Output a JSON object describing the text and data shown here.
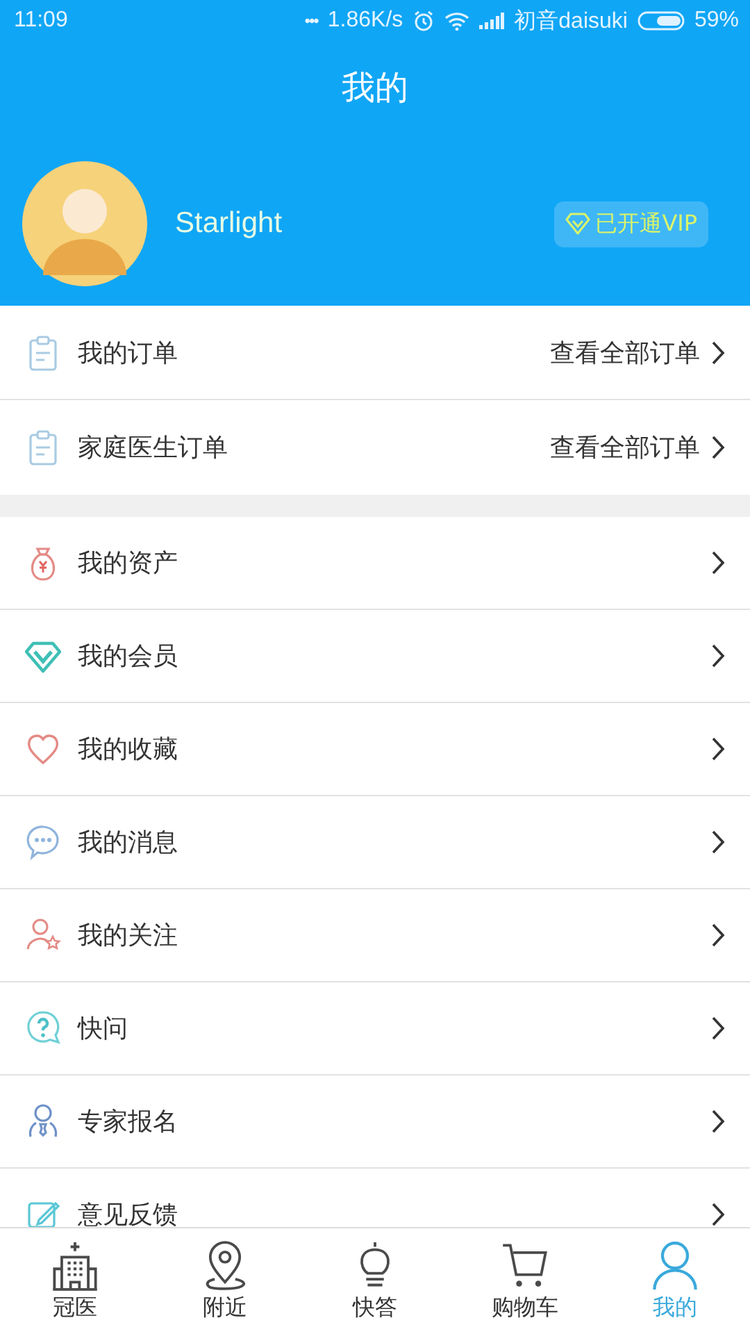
{
  "status_bar": {
    "time": "11:09",
    "dots": "•••",
    "speed": "1.86K/s",
    "carrier": "初音daisuki",
    "battery": "59%"
  },
  "title": "我的",
  "profile": {
    "name": "Starlight",
    "vip_badge": "已开通VIP"
  },
  "orders": [
    {
      "label": "我的订单",
      "link": "查看全部订单"
    },
    {
      "label": "家庭医生订单",
      "link": "查看全部订单"
    }
  ],
  "menu": [
    {
      "label": "我的资产"
    },
    {
      "label": "我的会员"
    },
    {
      "label": "我的收藏"
    },
    {
      "label": "我的消息"
    },
    {
      "label": "我的关注"
    },
    {
      "label": "快问"
    },
    {
      "label": "专家报名"
    },
    {
      "label": "意见反馈"
    }
  ],
  "tabs": [
    {
      "label": "冠医",
      "selected": false
    },
    {
      "label": "附近",
      "selected": false
    },
    {
      "label": "快答",
      "selected": false
    },
    {
      "label": "购物车",
      "selected": false
    },
    {
      "label": "我的",
      "selected": true
    }
  ]
}
